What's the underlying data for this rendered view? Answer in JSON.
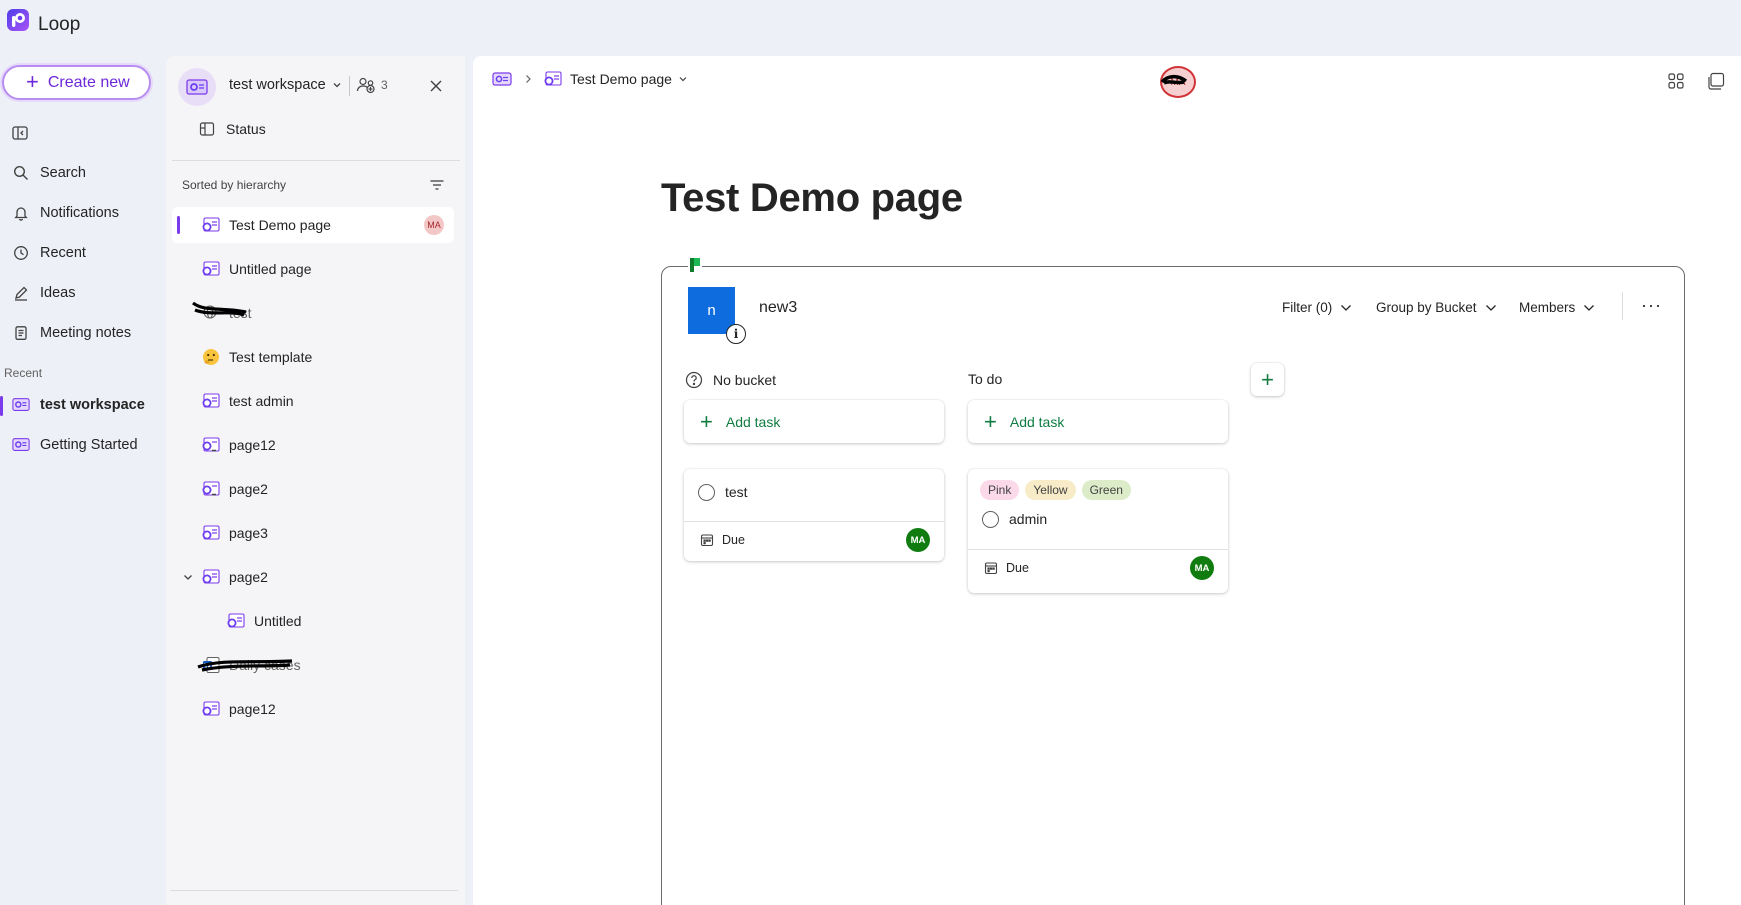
{
  "app": {
    "name": "Loop",
    "brand_color": "#7c3aed"
  },
  "nav": {
    "create_label": "Create new",
    "items": [
      {
        "label": "Search",
        "icon": "search-icon"
      },
      {
        "label": "Notifications",
        "icon": "bell-icon"
      },
      {
        "label": "Recent",
        "icon": "clock-icon"
      },
      {
        "label": "Ideas",
        "icon": "pen-icon"
      },
      {
        "label": "Meeting notes",
        "icon": "notes-icon"
      }
    ],
    "recent_caption": "Recent",
    "recent": [
      {
        "label": "test workspace",
        "selected": true
      },
      {
        "label": "Getting Started",
        "selected": false
      }
    ]
  },
  "workspace": {
    "name": "test workspace",
    "member_count": "3",
    "status_label": "Status",
    "sorted_label": "Sorted by hierarchy",
    "tree": [
      {
        "label": "Test Demo page",
        "selected": true,
        "badge": "MA"
      },
      {
        "label": "Untitled page"
      },
      {
        "label": "test",
        "redacted": true
      },
      {
        "label": "Test template",
        "icon": "emoji-thinking-icon"
      },
      {
        "label": "test admin"
      },
      {
        "label": "page12"
      },
      {
        "label": "page2"
      },
      {
        "label": "page3"
      },
      {
        "label": "page2",
        "expanded": true
      },
      {
        "label": "Untitled",
        "child": true
      },
      {
        "label": "Daily cases",
        "redacted": true
      },
      {
        "label": "page12"
      }
    ]
  },
  "page": {
    "breadcrumb_title": "Test Demo page",
    "presence_initials": "MA",
    "title": "Test Demo page"
  },
  "planner": {
    "tile_letter": "n",
    "name": "new3",
    "filter_label": "Filter (0)",
    "group_label": "Group by Bucket",
    "members_label": "Members",
    "more_label": "···",
    "buckets": [
      {
        "name": "No bucket",
        "add_label": "Add task",
        "tasks": [
          {
            "title": "test",
            "due_label": "Due",
            "assignee": "MA",
            "labels": []
          }
        ]
      },
      {
        "name": "To do",
        "add_label": "Add task",
        "tasks": [
          {
            "title": "admin",
            "due_label": "Due",
            "assignee": "MA",
            "labels": [
              {
                "text": "Pink",
                "color": "#fbd9e8"
              },
              {
                "text": "Yellow",
                "color": "#f7ecc7"
              },
              {
                "text": "Green",
                "color": "#dcecc8"
              }
            ]
          }
        ]
      }
    ]
  }
}
